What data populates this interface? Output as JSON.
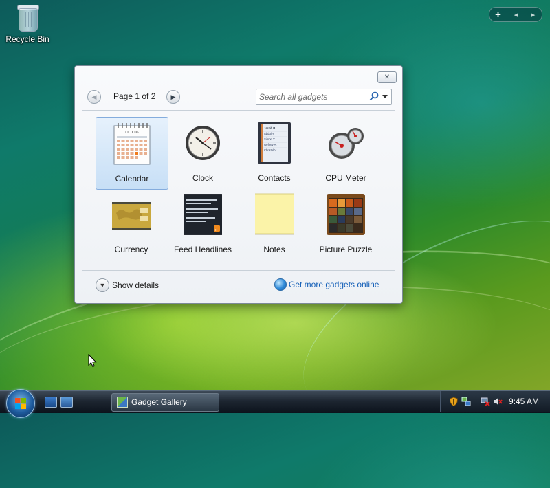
{
  "desktop": {
    "icons": [
      {
        "label": "Recycle Bin",
        "icon": "recycle-bin-icon"
      }
    ]
  },
  "sidebar_controls": {
    "add": "+",
    "prev": "◂",
    "next": "▸"
  },
  "gadget_gallery": {
    "close": "✕",
    "pager": {
      "label": "Page 1 of 2",
      "prev": "◀",
      "next": "▶"
    },
    "search": {
      "value": "",
      "placeholder": "Search all gadgets",
      "icon": "search-icon"
    },
    "gadgets": [
      {
        "label": "Calendar",
        "icon": "calendar-icon",
        "selected": true,
        "calendar_month": "OCT 06"
      },
      {
        "label": "Clock",
        "icon": "clock-icon"
      },
      {
        "label": "Contacts",
        "icon": "contacts-icon",
        "contact_names": [
          "Jacob B.",
          "Abdul Y.",
          "Simon Y.",
          "Geffrey A.",
          "Christel V."
        ]
      },
      {
        "label": "CPU Meter",
        "icon": "cpu-meter-icon"
      },
      {
        "label": "Currency",
        "icon": "currency-icon"
      },
      {
        "label": "Feed Headlines",
        "icon": "feed-headlines-icon"
      },
      {
        "label": "Notes",
        "icon": "notes-icon"
      },
      {
        "label": "Picture Puzzle",
        "icon": "picture-puzzle-icon"
      }
    ],
    "footer": {
      "show_details": "Show details",
      "get_more": "Get more gadgets online"
    }
  },
  "taskbar": {
    "buttons": [
      {
        "label": "Gadget Gallery",
        "icon": "gadget-gallery-icon"
      }
    ],
    "clock": "9:45 AM",
    "tray_icons": [
      "security-shield-icon",
      "network-icon",
      "network-disconnected-icon",
      "volume-muted-icon"
    ]
  },
  "colors": {
    "link": "#1560b8",
    "selection": "#c7dff6",
    "taskbar": "#1d2631"
  }
}
